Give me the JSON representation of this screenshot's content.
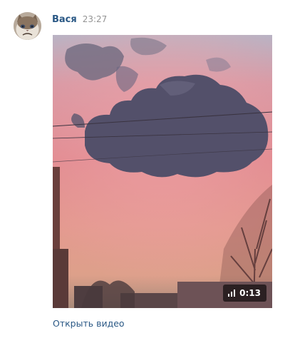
{
  "message": {
    "author": "Вася",
    "time": "23:27",
    "avatar_icon": "grumpy-cat-avatar"
  },
  "video": {
    "duration": "0:13",
    "duration_icon": "bars-icon",
    "open_link": "Открыть видео"
  },
  "colors": {
    "link": "#2a5885",
    "time": "#939393",
    "badge_bg": "rgba(0,0,0,0.6)"
  }
}
